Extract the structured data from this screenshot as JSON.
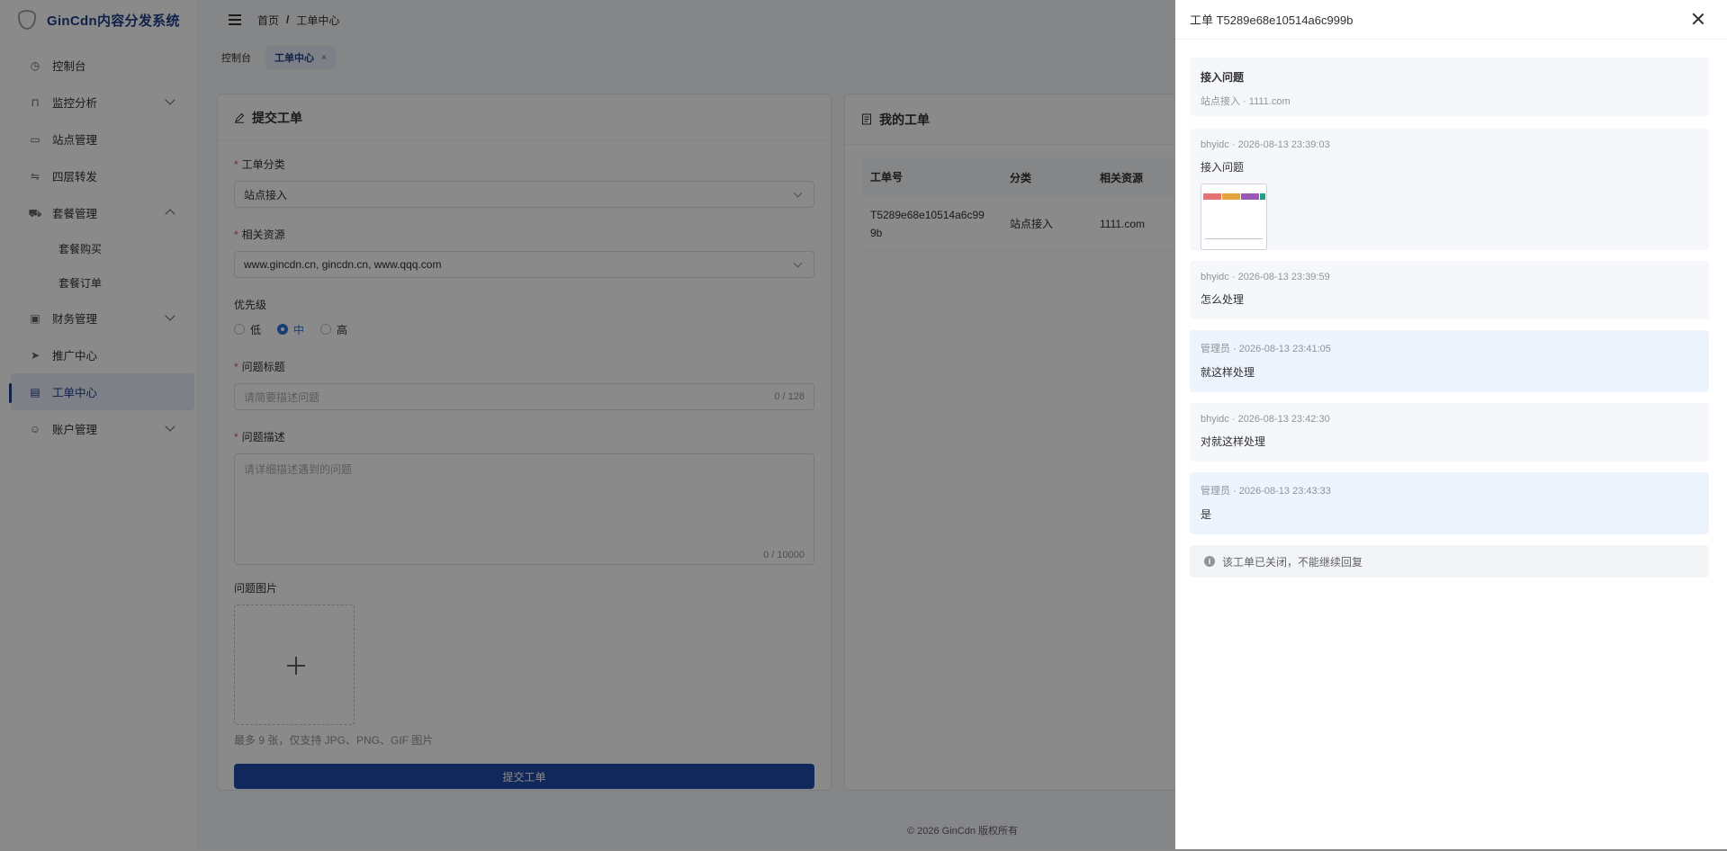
{
  "app": {
    "title": "GinCdn内容分发系统"
  },
  "sidebar": {
    "items": [
      {
        "label": "控制台",
        "icon": "dashboard-icon"
      },
      {
        "label": "监控分析",
        "icon": "monitor-icon"
      },
      {
        "label": "站点管理",
        "icon": "desktop-icon"
      },
      {
        "label": "四层转发",
        "icon": "forward-icon"
      },
      {
        "label": "套餐管理",
        "icon": "cart-icon"
      },
      {
        "label": "套餐购买"
      },
      {
        "label": "套餐订单"
      },
      {
        "label": "财务管理",
        "icon": "wallet-icon"
      },
      {
        "label": "推广中心",
        "icon": "send-icon"
      },
      {
        "label": "工单中心",
        "icon": "ticket-icon"
      },
      {
        "label": "账户管理",
        "icon": "user-icon"
      }
    ]
  },
  "header": {
    "breadcrumb": [
      "首页",
      "工单中心"
    ],
    "sep": "/"
  },
  "tabs": [
    {
      "label": "控制台"
    },
    {
      "label": "工单中心",
      "close": "×"
    }
  ],
  "form": {
    "title": "提交工单",
    "category_label": "工单分类",
    "category_value": "站点接入",
    "resource_label": "相关资源",
    "resource_value": "www.gincdn.cn, gincdn.cn, www.qqq.com",
    "priority_label": "优先级",
    "priority_options": [
      "低",
      "中",
      "高"
    ],
    "priority_selected": "中",
    "subject_label": "问题标题",
    "subject_placeholder": "请简要描述问题",
    "subject_count": "0 / 128",
    "desc_label": "问题描述",
    "desc_placeholder": "请详细描述遇到的问题",
    "desc_count": "0 / 10000",
    "images_label": "问题图片",
    "images_hint": "最多 9 张，仅支持 JPG、PNG、GIF 图片",
    "submit_label": "提交工单"
  },
  "my_tickets": {
    "title": "我的工单",
    "columns": [
      "工单号",
      "分类",
      "相关资源"
    ],
    "rows": [
      {
        "id_line1": "T5289e68e10514a6c99",
        "id_line2": "9b",
        "category": "站点接入",
        "resource": "1111.com"
      }
    ]
  },
  "footer": {
    "text": "© 2026 GinCdn 版权所有"
  },
  "drawer": {
    "title": "工单 T5289e68e10514a6c999b",
    "info_title": "接入问题",
    "info_sub": "站点接入 · 1111.com",
    "messages": [
      {
        "meta": "bhyidc · 2026-08-13 23:39:03",
        "text": "接入问题",
        "admin": false
      },
      {
        "meta": "bhyidc · 2026-08-13 23:39:59",
        "text": "怎么处理",
        "admin": false
      },
      {
        "meta": "管理员 · 2026-08-13 23:41:05",
        "text": "就这样处理",
        "admin": true
      },
      {
        "meta": "bhyidc · 2026-08-13 23:42:30",
        "text": "对就这样处理",
        "admin": false
      },
      {
        "meta": "管理员 · 2026-08-13 23:43:33",
        "text": "是",
        "admin": true
      }
    ],
    "closed_notice": "该工单已关闭，不能继续回复",
    "notice_icon": "i"
  },
  "colors": {
    "primary": "#1f4aa8",
    "accent": "#2f6fd6",
    "admin_bg": "#eef4fd"
  }
}
